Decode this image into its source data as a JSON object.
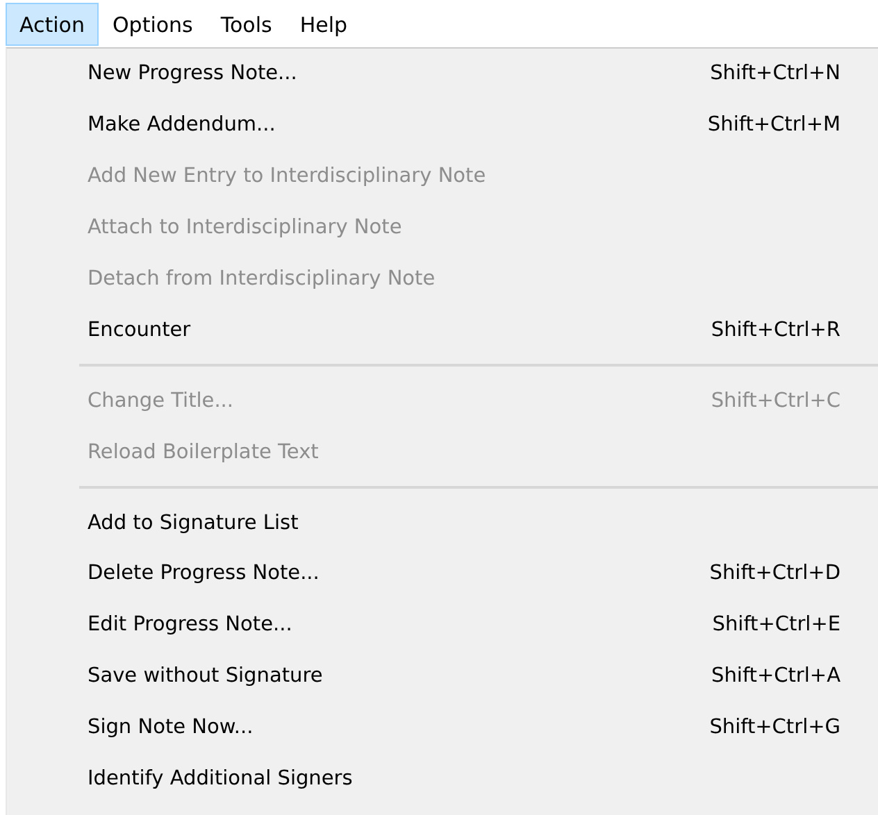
{
  "menu_bar": [
    {
      "label": "Action",
      "selected": true
    },
    {
      "label": "Options",
      "selected": false
    },
    {
      "label": "Tools",
      "selected": false
    },
    {
      "label": "Help",
      "selected": false
    }
  ],
  "menu": {
    "items": [
      {
        "kind": "item",
        "label": "New Progress Note...",
        "shortcut": "Shift+Ctrl+N",
        "disabled": false
      },
      {
        "kind": "item",
        "label": "Make Addendum...",
        "shortcut": "Shift+Ctrl+M",
        "disabled": false
      },
      {
        "kind": "item",
        "label": "Add New Entry to Interdisciplinary Note",
        "disabled": true
      },
      {
        "kind": "item",
        "label": "Attach to Interdisciplinary Note",
        "disabled": true
      },
      {
        "kind": "item",
        "label": "Detach from Interdisciplinary Note",
        "disabled": true
      },
      {
        "kind": "item",
        "label": "Encounter",
        "shortcut": "Shift+Ctrl+R",
        "disabled": false
      },
      {
        "kind": "separator"
      },
      {
        "kind": "item",
        "label": "Change Title...",
        "shortcut": "Shift+Ctrl+C",
        "disabled": true
      },
      {
        "kind": "item",
        "label": "Reload Boilerplate Text",
        "disabled": true
      },
      {
        "kind": "separator"
      },
      {
        "kind": "item",
        "label": "Add to Signature List",
        "disabled": false
      },
      {
        "kind": "item",
        "label": "Delete Progress Note...",
        "shortcut": "Shift+Ctrl+D",
        "disabled": false
      },
      {
        "kind": "item",
        "label": "Edit Progress Note...",
        "shortcut": "Shift+Ctrl+E",
        "disabled": false
      },
      {
        "kind": "item",
        "label": "Save without Signature",
        "shortcut": "Shift+Ctrl+A",
        "disabled": false
      },
      {
        "kind": "item",
        "label": "Sign Note Now...",
        "shortcut": "Shift+Ctrl+G",
        "disabled": false
      },
      {
        "kind": "item",
        "label": "Identify Additional Signers",
        "disabled": false
      }
    ]
  }
}
